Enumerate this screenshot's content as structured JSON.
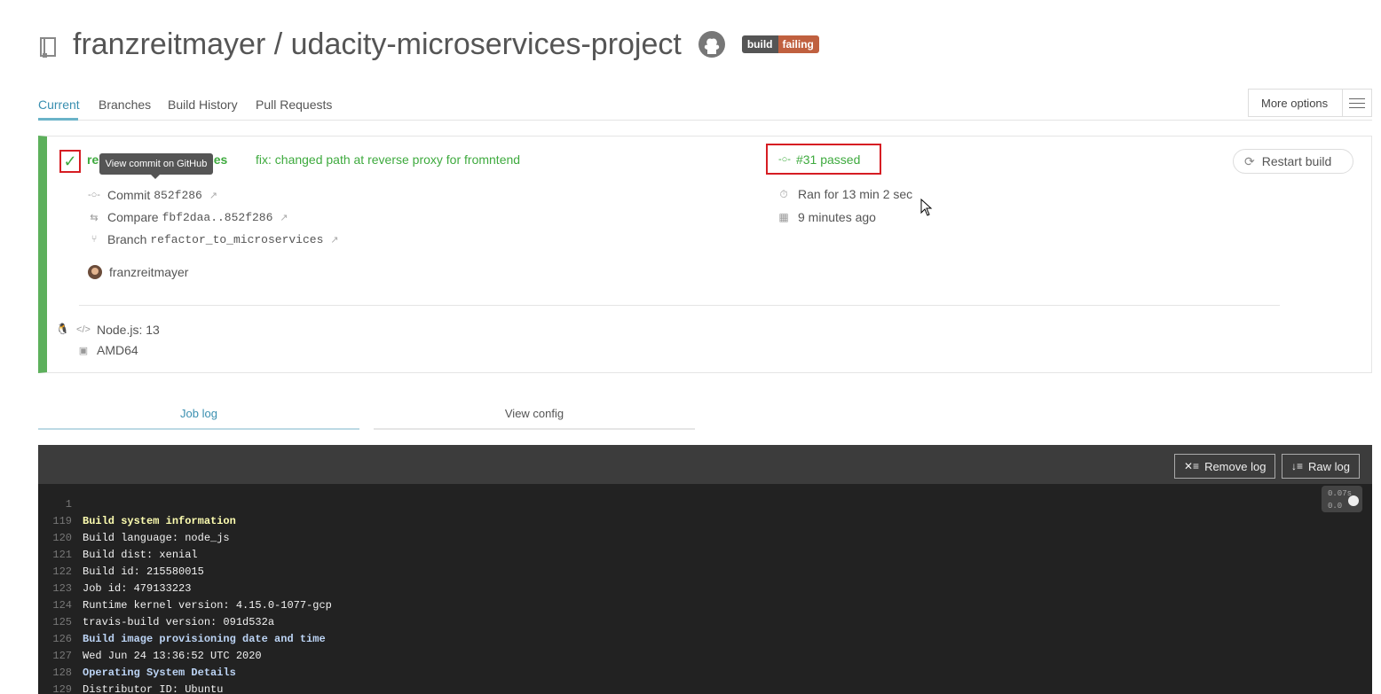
{
  "header": {
    "title": "franzreitmayer / udacity-microservices-project",
    "badge_left": "build",
    "badge_right": "failing",
    "badge_right_color": "#c0603f"
  },
  "tabs": {
    "items": [
      "Current",
      "Branches",
      "Build History",
      "Pull Requests"
    ],
    "active": "Current",
    "more_options": "More options"
  },
  "build": {
    "status_color": "#5db05c",
    "branch_name": "refactor_to_microservices",
    "branch_visible": "vices",
    "branch_prefix_visible": "re",
    "commit_message": "fix: changed path at reverse proxy for fromntend",
    "tooltip": "View commit on GitHub",
    "commit_label": "Commit",
    "commit_sha": "852f286",
    "compare_label": "Compare",
    "compare_range": "fbf2daa..852f286",
    "branch_label": "Branch",
    "branch_value": "refactor_to_microservices",
    "author": "franzreitmayer",
    "build_number": "#31 passed",
    "duration": "Ran for 13 min 2 sec",
    "finished": "9 minutes ago",
    "restart_label": "Restart build",
    "language": "Node.js: 13",
    "arch": "AMD64"
  },
  "log_tabs": {
    "job_log": "Job log",
    "view_config": "View config"
  },
  "log": {
    "remove_label": "Remove log",
    "raw_label": "Raw log",
    "timer_1": "0.07s",
    "timer_2": "0.0",
    "lines": [
      {
        "num": "1",
        "text": "",
        "style": ""
      },
      {
        "num": "119",
        "text": "Build system information",
        "style": "y"
      },
      {
        "num": "120",
        "text": "Build language: node_js",
        "style": ""
      },
      {
        "num": "121",
        "text": "Build dist: xenial",
        "style": ""
      },
      {
        "num": "122",
        "text": "Build id: 215580015",
        "style": ""
      },
      {
        "num": "123",
        "text": "Job id: 479133223",
        "style": ""
      },
      {
        "num": "124",
        "text": "Runtime kernel version: 4.15.0-1077-gcp",
        "style": ""
      },
      {
        "num": "125",
        "text": "travis-build version: 091d532a",
        "style": ""
      },
      {
        "num": "126",
        "text": "Build image provisioning date and time",
        "style": "b"
      },
      {
        "num": "127",
        "text": "Wed Jun 24 13:36:52 UTC 2020",
        "style": ""
      },
      {
        "num": "128",
        "text": "Operating System Details",
        "style": "b"
      },
      {
        "num": "129",
        "text": "Distributor ID: Ubuntu",
        "style": ""
      }
    ]
  }
}
